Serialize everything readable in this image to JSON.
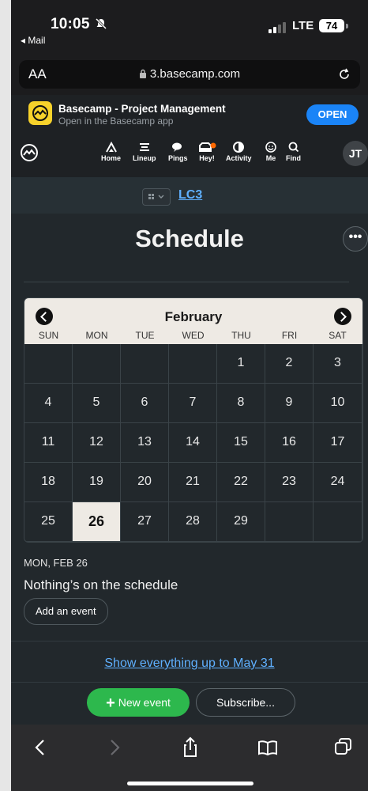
{
  "status_bar": {
    "time": "10:05",
    "back_app": "◂ Mail",
    "network": "LTE",
    "battery": "74"
  },
  "url_bar": {
    "aa": "AA",
    "url": "3.basecamp.com"
  },
  "app_banner": {
    "title": "Basecamp - Project Management",
    "subtitle": "Open in the Basecamp app",
    "open_label": "OPEN"
  },
  "nav": {
    "items": [
      {
        "label": "Home",
        "icon": "home-icon"
      },
      {
        "label": "Lineup",
        "icon": "lineup-icon"
      },
      {
        "label": "Pings",
        "icon": "pings-icon"
      },
      {
        "label": "Hey!",
        "icon": "hey-icon"
      },
      {
        "label": "Activity",
        "icon": "activity-icon"
      },
      {
        "label": "Me",
        "icon": "me-icon"
      },
      {
        "label": "Find",
        "icon": "find-icon"
      }
    ],
    "avatar": "JT",
    "hey_badge_color": "#ff6a00"
  },
  "project": {
    "name": "LC3"
  },
  "page": {
    "title": "Schedule",
    "more": "•••"
  },
  "calendar": {
    "month": "February",
    "weekdays": [
      "SUN",
      "MON",
      "TUE",
      "WED",
      "THU",
      "FRI",
      "SAT"
    ],
    "weeks": [
      [
        "",
        "",
        "",
        "",
        "1",
        "2",
        "3"
      ],
      [
        "4",
        "5",
        "6",
        "7",
        "8",
        "9",
        "10"
      ],
      [
        "11",
        "12",
        "13",
        "14",
        "15",
        "16",
        "17"
      ],
      [
        "18",
        "19",
        "20",
        "21",
        "22",
        "23",
        "24"
      ],
      [
        "25",
        "26",
        "27",
        "28",
        "29",
        "",
        ""
      ]
    ],
    "today": "26"
  },
  "selected_day": {
    "date_label": "MON, FEB 26",
    "empty_message": "Nothing’s on the schedule",
    "add_label": "Add an event"
  },
  "footer": {
    "show_more": "Show everything up to May 31",
    "new_event": "New event",
    "subscribe": "Subscribe..."
  },
  "colors": {
    "accent_link": "#5fb0ff",
    "new_event_green": "#2db84d",
    "open_blue": "#1a84f7"
  }
}
